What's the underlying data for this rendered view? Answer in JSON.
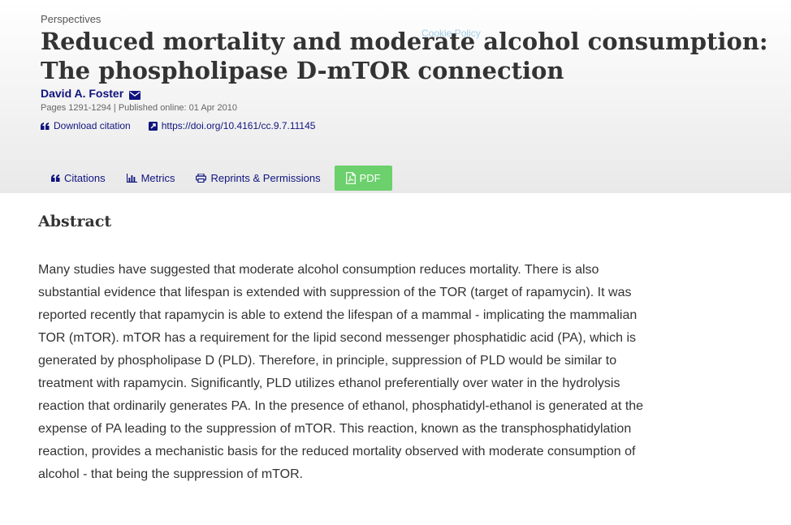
{
  "header": {
    "section": "Perspectives",
    "cookie_link": "Cookie Policy",
    "title": "Reduced mortality and moderate alcohol consumption: The phospholipase D-mTOR connection",
    "author": "David A. Foster",
    "meta": "Pages 1291-1294 | Published online: 01 Apr 2010",
    "download_citation": "Download citation",
    "doi": "https://doi.org/10.4161/cc.9.7.11145"
  },
  "tabs": {
    "citations": "Citations",
    "metrics": "Metrics",
    "reprints": "Reprints & Permissions",
    "pdf": "PDF"
  },
  "abstract": {
    "heading": "Abstract",
    "lines": [
      "Many studies have suggested that moderate alcohol consumption reduces mortality.  There is also",
      "substantial evidence that lifespan is extended with suppression of the TOR (target of rapamycin).  It was",
      "reported recently that rapamycin is able to extend the lifespan of a mammal - implicating the mammalian",
      "TOR (mTOR).  mTOR has a requirement for the lipid second messenger phosphatidic acid (PA), which is",
      "generated by phospholipase D (PLD).  Therefore, in principle, suppression of PLD would be similar to",
      "treatment with rapamycin.  Significantly, PLD utilizes ethanol preferentially over water in the hydrolysis",
      "reaction that ordinarily generates PA.  In the presence of ethanol, phosphatidyl-ethanol is generated at the",
      "expense of PA leading to the suppression of mTOR.  This reaction, known as the transphosphatidylation",
      "reaction, provides a mechanistic basis for the reduced mortality observed with moderate consumption of",
      "alcohol - that being the suppression of mTOR."
    ]
  },
  "colors": {
    "link": "#10147e",
    "pdf_button": "#6cd06c",
    "text": "#333333"
  },
  "icons": [
    "mail-icon",
    "quote-icon",
    "external-link-icon",
    "bar-chart-icon",
    "printer-icon",
    "pdf-file-icon"
  ]
}
